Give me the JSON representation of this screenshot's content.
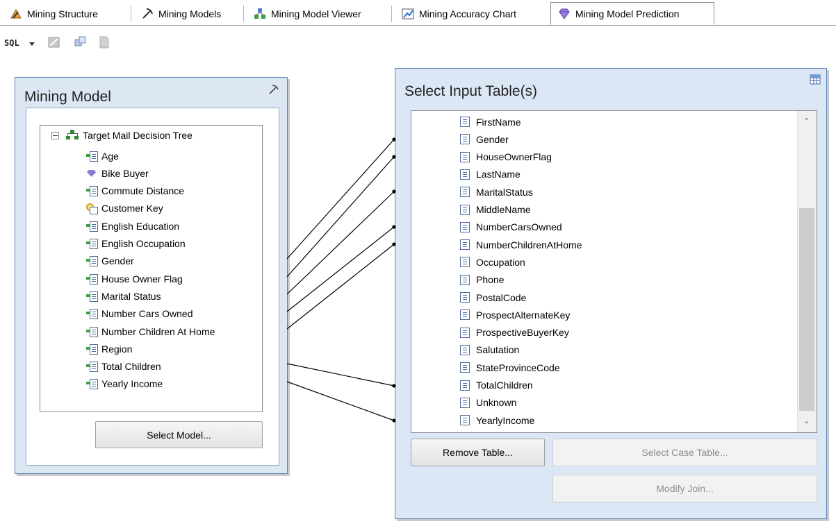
{
  "tabs": [
    {
      "label": "Mining Structure",
      "icon": "mining-structure-icon"
    },
    {
      "label": "Mining Models",
      "icon": "pickaxe-icon"
    },
    {
      "label": "Mining Model Viewer",
      "icon": "model-viewer-icon"
    },
    {
      "label": "Mining Accuracy Chart",
      "icon": "accuracy-chart-icon"
    },
    {
      "label": "Mining Model Prediction",
      "icon": "gem-icon",
      "active": true
    }
  ],
  "toolbar": {
    "sql_label": "SQL"
  },
  "mining_model": {
    "title": "Mining Model",
    "root": "Target Mail Decision Tree",
    "columns": [
      {
        "label": "Age",
        "icon": "input-column-icon"
      },
      {
        "label": "Bike Buyer",
        "icon": "predict-column-icon"
      },
      {
        "label": "Commute Distance",
        "icon": "input-column-icon"
      },
      {
        "label": "Customer Key",
        "icon": "key-column-icon"
      },
      {
        "label": "English Education",
        "icon": "input-column-icon"
      },
      {
        "label": "English Occupation",
        "icon": "input-column-icon"
      },
      {
        "label": "Gender",
        "icon": "input-column-icon"
      },
      {
        "label": "House Owner Flag",
        "icon": "input-column-icon"
      },
      {
        "label": "Marital Status",
        "icon": "input-column-icon"
      },
      {
        "label": "Number Cars Owned",
        "icon": "input-column-icon"
      },
      {
        "label": "Number Children At Home",
        "icon": "input-column-icon"
      },
      {
        "label": "Region",
        "icon": "input-column-icon"
      },
      {
        "label": "Total Children",
        "icon": "input-column-icon"
      },
      {
        "label": "Yearly Income",
        "icon": "input-column-icon"
      }
    ],
    "select_button": "Select Model..."
  },
  "input_table": {
    "title": "Select Input Table(s)",
    "columns": [
      "FirstName",
      "Gender",
      "HouseOwnerFlag",
      "LastName",
      "MaritalStatus",
      "MiddleName",
      "NumberCarsOwned",
      "NumberChildrenAtHome",
      "Occupation",
      "Phone",
      "PostalCode",
      "ProspectAlternateKey",
      "ProspectiveBuyerKey",
      "Salutation",
      "StateProvinceCode",
      "TotalChildren",
      "Unknown",
      "YearlyIncome"
    ],
    "remove_button": "Remove Table...",
    "case_table_button": "Select Case Table...",
    "modify_join_button": "Modify Join..."
  }
}
